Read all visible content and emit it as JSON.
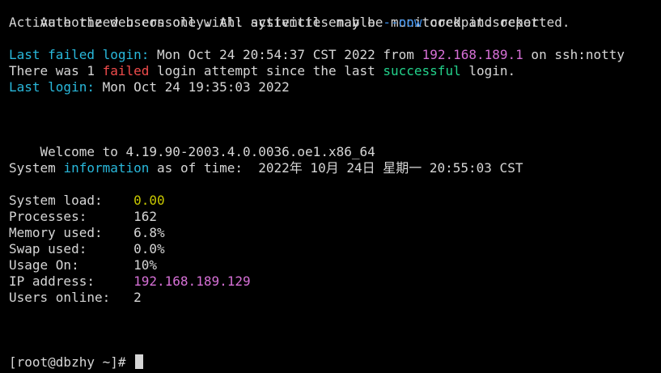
{
  "banner": {
    "line1": "Authorized users only. All activities may be monitored and reported.",
    "line2_prefix": "Activate the web console with: systemctl enable ",
    "line2_flag": "--now",
    "line2_suffix": " cockpit.socket"
  },
  "last_failed": {
    "label_a": "Last ",
    "label_b": "failed",
    "label_c": " login:",
    "date": " Mon Oct 24 20:54:37 CST 2022 from ",
    "ip": "192.168.189.1",
    "suffix": " on ssh:notty"
  },
  "failed_attempts": {
    "prefix": "There was 1 ",
    "failed": "failed",
    "middle": " login attempt since the last ",
    "successful": "successful",
    "suffix": " login."
  },
  "last_login": {
    "label": "Last login:",
    "date": " Mon Oct 24 19:35:03 2022"
  },
  "welcome": "Welcome to 4.19.90-2003.4.0.0036.oe1.x86_64",
  "sysinfo": {
    "prefix": "System ",
    "information": "information",
    "suffix": " as of time:  2022年 10月 24日 星期一 20:55:03 CST"
  },
  "stats": [
    {
      "label": "System load:    ",
      "value": "0.00",
      "color": "#c8c800"
    },
    {
      "label": "Processes:      ",
      "value": "162",
      "color": "#d6d6d6"
    },
    {
      "label": "Memory used:    ",
      "value": "6.8%",
      "color": "#d6d6d6"
    },
    {
      "label": "Swap used:      ",
      "value": "0.0%",
      "color": "#d6d6d6"
    },
    {
      "label": "Usage On:       ",
      "value": "10%",
      "color": "#d6d6d6"
    },
    {
      "label": "IP address:     ",
      "value": "192.168.189.129",
      "color": "#d670d6"
    },
    {
      "label": "Users online:   ",
      "value": "2",
      "color": "#d6d6d6"
    }
  ],
  "prompt": "[root@dbzhy ~]# ",
  "colors": {
    "background": "#000000",
    "foreground": "#d6d6d6",
    "blue": "#3b8eea",
    "red": "#f14c4c",
    "magenta": "#d670d6",
    "green": "#23d18b",
    "yellow": "#c8c800"
  }
}
